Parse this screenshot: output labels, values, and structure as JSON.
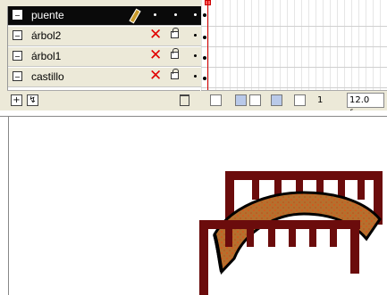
{
  "layers": [
    {
      "name": "puente",
      "selected": true
    },
    {
      "name": "árbol2",
      "selected": false
    },
    {
      "name": "árbol1",
      "selected": false
    },
    {
      "name": "castillo",
      "selected": false
    }
  ],
  "timeline": {
    "current_frame": "1",
    "frame_rate": "12.0 fps"
  },
  "colors": {
    "bridge_rail": "#6b0c0c",
    "bridge_deck": "#b5702e",
    "playhead": "#d40000",
    "hidden_mark": "#e00000"
  },
  "icons": {
    "layer_type": "layer-icon",
    "hidden": "red-x-icon",
    "lock": "lock-icon",
    "pencil": "pencil-icon",
    "trash": "trash-icon"
  }
}
